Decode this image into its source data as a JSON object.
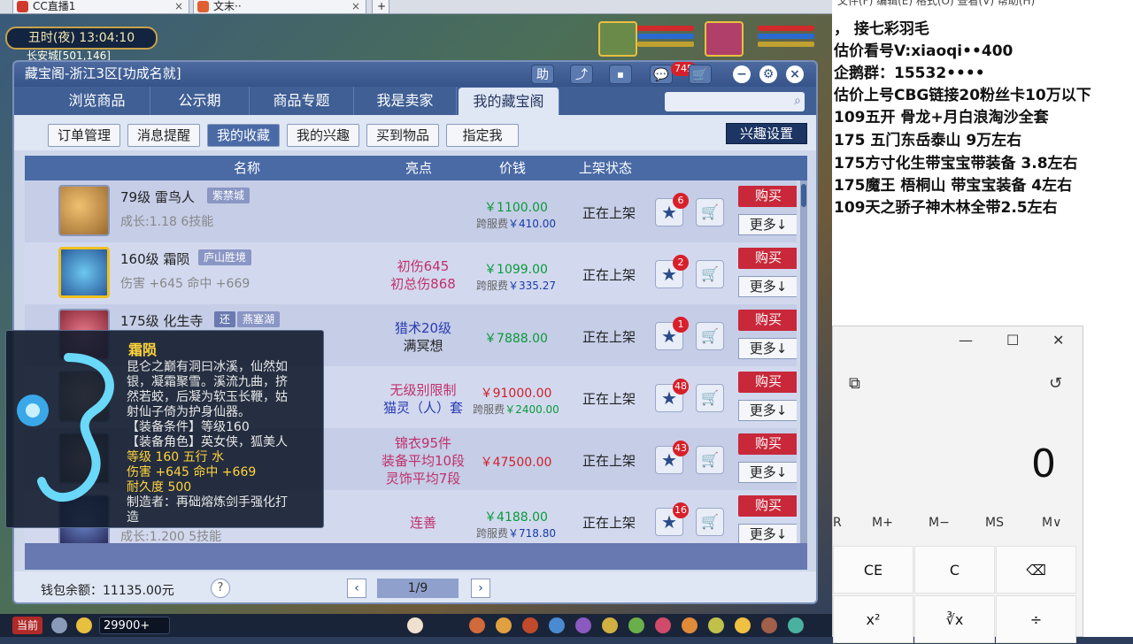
{
  "browser": {
    "tabs": [
      {
        "label": "CC直播1",
        "close": "×"
      },
      {
        "label": "文末··",
        "close": "×"
      }
    ],
    "newtab": "+"
  },
  "game": {
    "clock": "丑时(夜)  13:04:10",
    "location": "长安城[501,146]"
  },
  "window": {
    "title": "藏宝阁-浙江3区[功成名就]",
    "header_buttons": [
      "助",
      "⤴",
      "⏹",
      "💬",
      "🛒"
    ],
    "message_count": "745",
    "nav_tabs": [
      "浏览商品",
      "公示期",
      "商品专题",
      "我是卖家",
      "我的藏宝阁"
    ],
    "active_tab": "我的藏宝阁",
    "sub_buttons": [
      "订单管理",
      "消息提醒",
      "我的收藏",
      "我的兴趣",
      "买到物品",
      "指定我"
    ],
    "active_sub": "我的收藏",
    "interest_button": "兴趣设置",
    "columns": [
      "名称",
      "亮点",
      "价钱",
      "上架状态"
    ],
    "rows": [
      {
        "name": "79级 雷鸟人",
        "tag": "紫禁城",
        "sub": "成长:1.18 6技能",
        "hl1": "",
        "hl2": "",
        "price": "￥1100.00",
        "fee_label": "跨服费",
        "fee": "￥410.00",
        "status": "正在上架",
        "fav": "6",
        "buy": "购买",
        "more": "更多↓"
      },
      {
        "name": "160级 霜陨",
        "tag": "庐山胜境",
        "sub": "伤害 +645 命中 +669",
        "hl1": "初伤645",
        "hl2": "初总伤868",
        "price": "￥1099.00",
        "fee_label": "跨服费",
        "fee": "￥335.27",
        "status": "正在上架",
        "fav": "2",
        "buy": "购买",
        "more": "更多↓"
      },
      {
        "name": "175级 化生寺",
        "tag": "还",
        "tag2": "燕塞湖",
        "sub": "",
        "hl1": "猎术20级",
        "hl2": "满冥想",
        "price": "￥7888.00",
        "fee_label": "",
        "fee": "",
        "status": "正在上架",
        "fav": "1",
        "buy": "购买",
        "more": "更多↓"
      },
      {
        "name": "",
        "tag": "",
        "sub": "",
        "hl1": "无级别限制",
        "hl2": "猫灵（人）套",
        "price": "￥91000.00",
        "fee_label": "跨服费",
        "fee": "￥2400.00",
        "status": "正在上架",
        "fav": "48",
        "buy": "购买",
        "more": "更多↓"
      },
      {
        "name": "",
        "tag": "",
        "sub": "",
        "hl1": "锦衣95件",
        "hl2": "装备平均10段",
        "hl3": "灵饰平均7段",
        "price": "￥47500.00",
        "fee_label": "",
        "fee": "",
        "status": "正在上架",
        "fav": "43",
        "buy": "购买",
        "more": "更多↓"
      },
      {
        "name": "",
        "tag": "",
        "sub": "成长:1.200 5技能",
        "hl1": "连善",
        "hl2": "",
        "price": "￥4188.00",
        "fee_label": "跨服费",
        "fee": "￥718.80",
        "status": "正在上架",
        "fav": "16",
        "buy": "购买",
        "more": "更多↓"
      }
    ],
    "wallet": "钱包余额：11135.00元",
    "help": "?",
    "page": "1/9",
    "prev": "‹",
    "next": "›"
  },
  "tooltip": {
    "title": "霜陨",
    "desc1": "昆仑之巅有洞曰冰溪，仙然如",
    "desc2": "银，凝霜聚雪。溪流九曲，挤",
    "desc3": "然若蛟，后凝为软玉长鞭，姑",
    "desc4": "射仙子倚为护身仙器。",
    "req1": "【装备条件】等级160",
    "req2": "【装备角色】英女侠，狐美人",
    "level": "等级 160  五行 水",
    "dmg": "伤害 +645 命中 +669",
    "dur": "耐久度 500",
    "maker1": "制造者：再础熔炼剑手强化打",
    "maker2": "造"
  },
  "taskbar": {
    "start": "当前",
    "gold": "29900+"
  },
  "notes": {
    "menu": "文件(F)   编辑(E)   格式(O)   查看(V)   帮助(H)",
    "lines": [
      "，    接七彩羽毛",
      "估价看号V:xiaoqi••400",
      "企鹅群：15532••••",
      "估价上号CBG链接20粉丝卡10万以下",
      "109五开 骨龙+月白浪淘沙全套",
      "175 五门东岳泰山  9万左右",
      "175方寸化生带宝宝带装备  3.8左右",
      "175魔王 梧桐山  带宝宝装备 4左右",
      "109天之骄子神木林全带2.5左右"
    ]
  },
  "calculator": {
    "minimize": "—",
    "maximize": "☐",
    "close": "✕",
    "display": "0",
    "memory": [
      "R",
      "M+",
      "M−",
      "MS",
      "M∨"
    ],
    "keys": [
      "CE",
      "C",
      "⌫",
      "x²",
      "∛x",
      "÷"
    ]
  },
  "colors": {
    "accent": "#3f5f95",
    "buy": "#c8283a",
    "price": "#0a9a38",
    "highlight": "#c0306a"
  }
}
